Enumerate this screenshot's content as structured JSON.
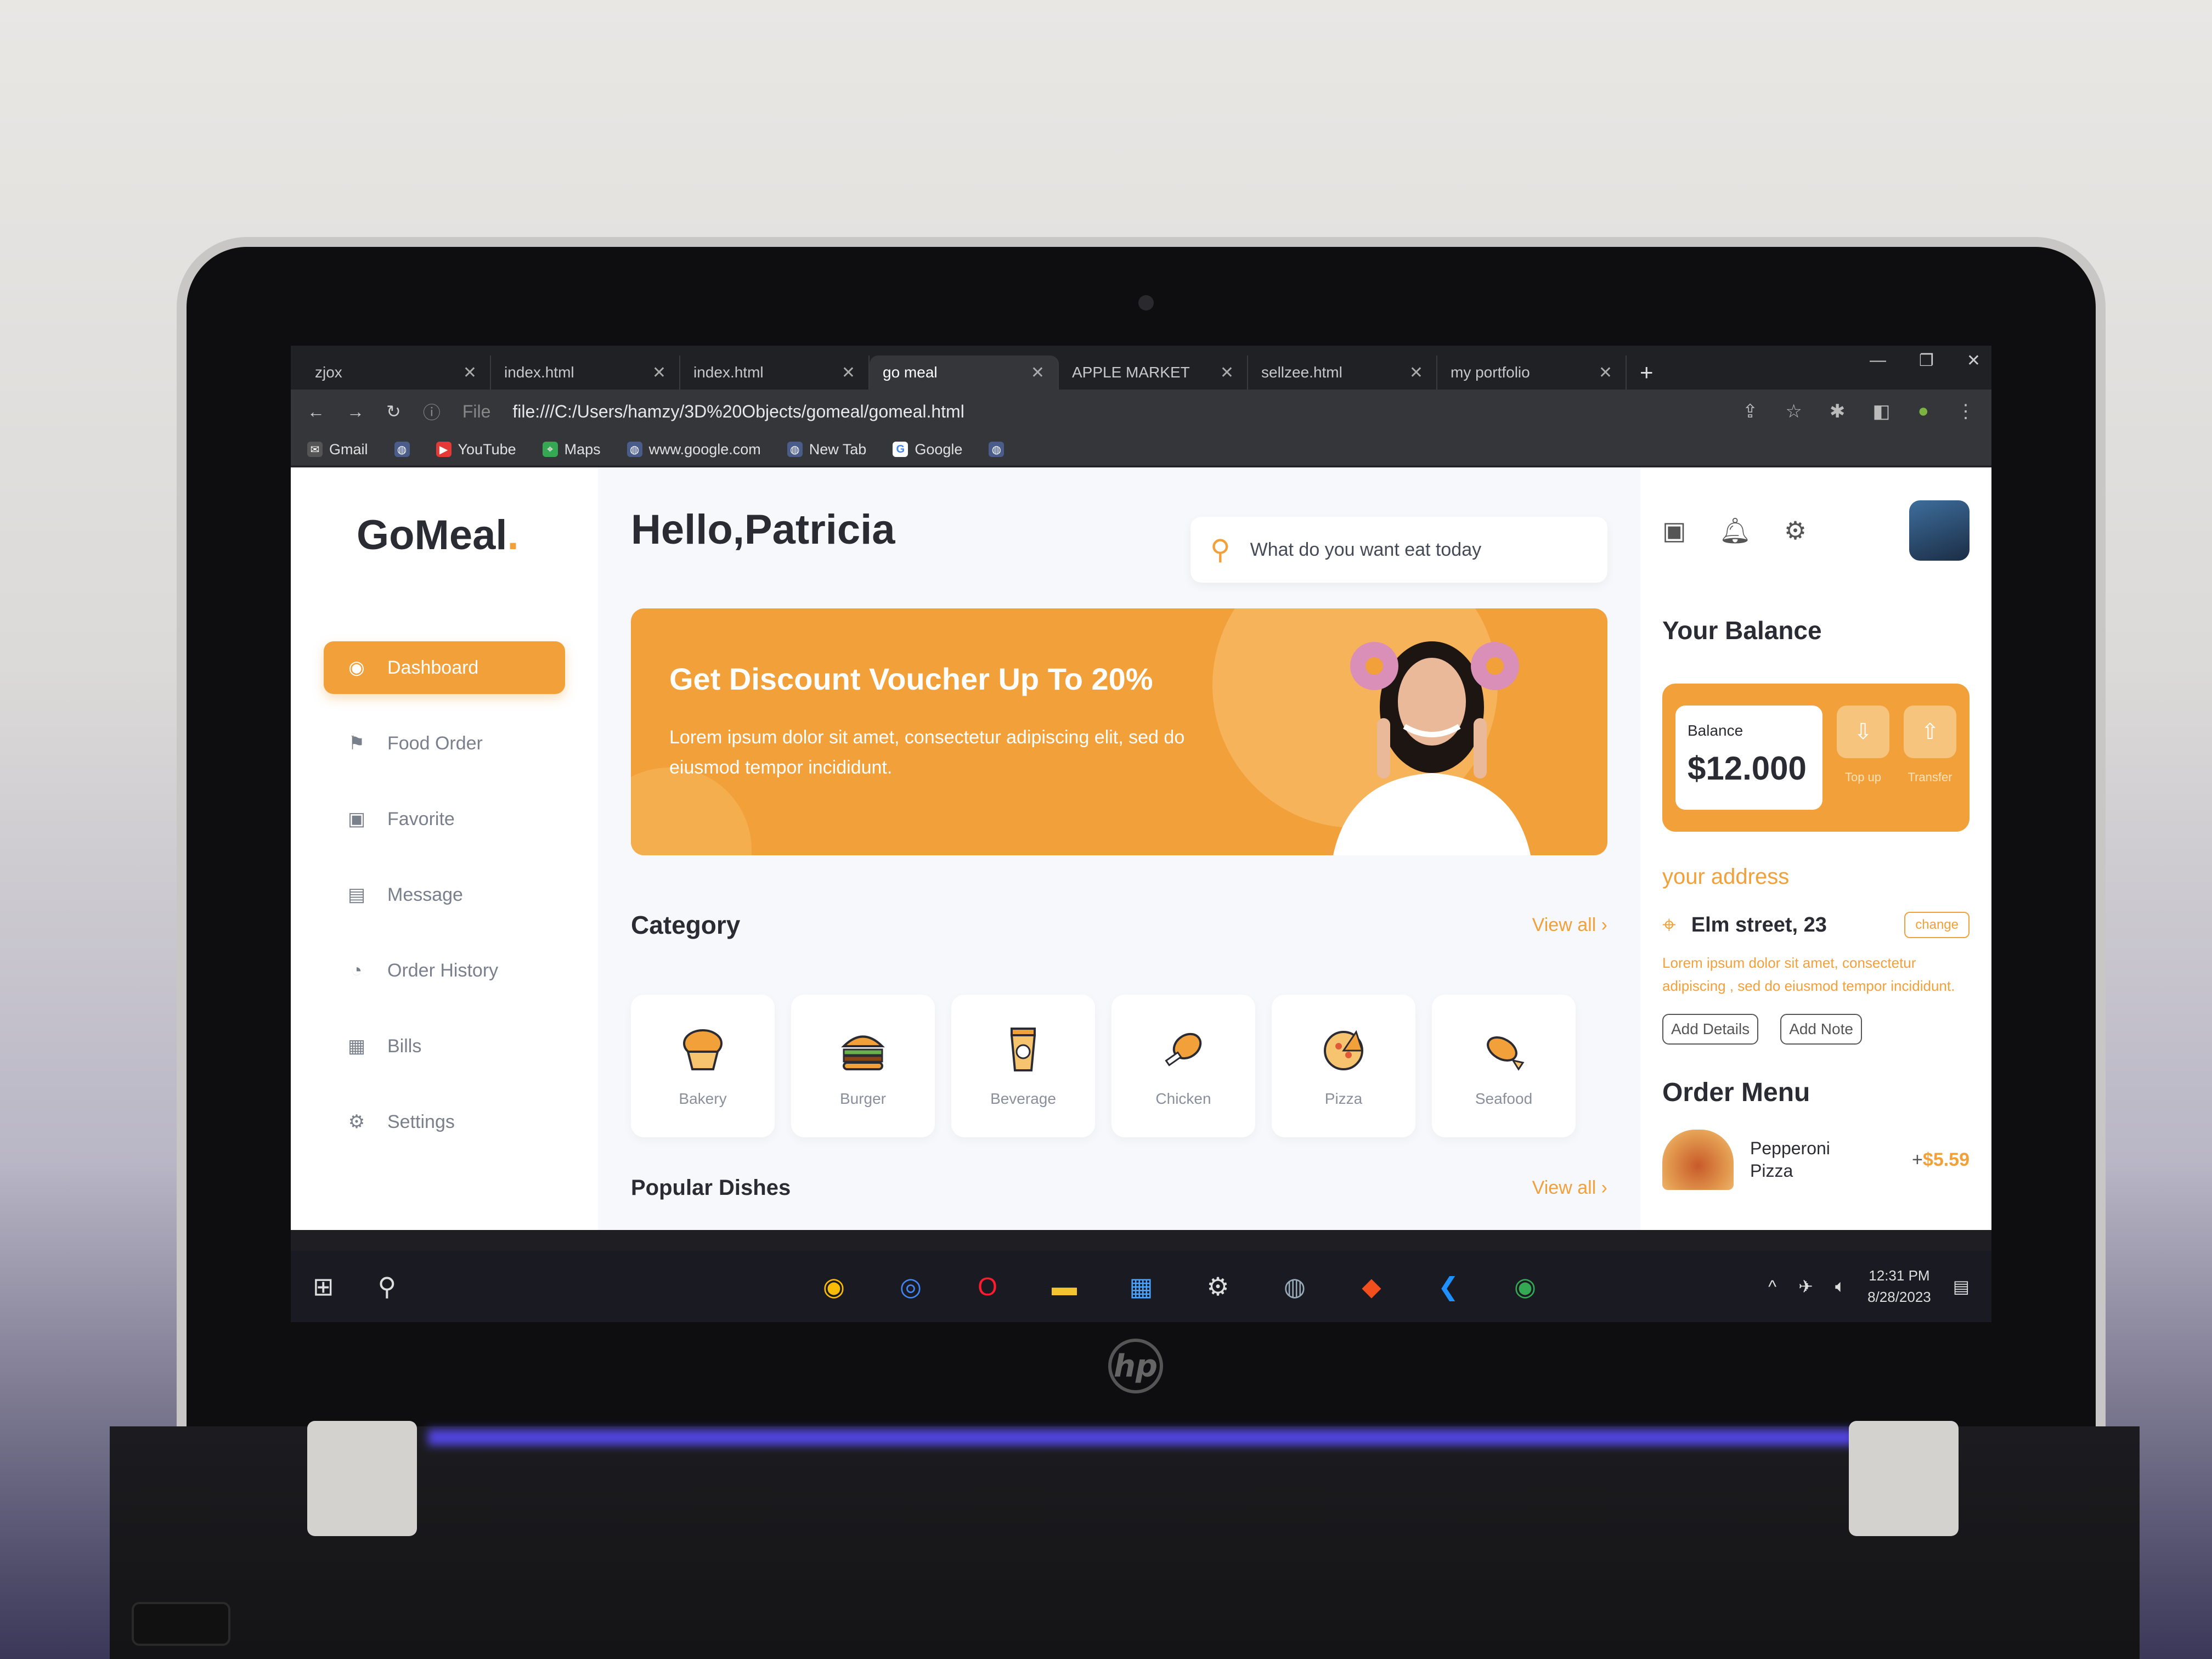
{
  "browser": {
    "tabs": [
      {
        "label": "zjox",
        "active": false
      },
      {
        "label": "index.html",
        "active": false
      },
      {
        "label": "index.html",
        "active": false
      },
      {
        "label": "go meal",
        "active": true
      },
      {
        "label": "APPLE MARKET",
        "active": false
      },
      {
        "label": "sellzee.html",
        "active": false
      },
      {
        "label": "my portfolio",
        "active": false
      }
    ],
    "url": "file:///C:/Users/hamzy/3D%20Objects/gomeal/gomeal.html",
    "url_prefix": "File",
    "bookmarks": [
      "Gmail",
      "YouTube",
      "Maps",
      "www.google.com",
      "New Tab",
      "Google"
    ]
  },
  "app": {
    "logo": "GoMeal",
    "logo_dot": ".",
    "nav": [
      {
        "label": "Dashboard",
        "icon": "dashboard-icon",
        "active": true
      },
      {
        "label": "Food Order",
        "icon": "food-order-icon",
        "active": false
      },
      {
        "label": "Favorite",
        "icon": "favorite-icon",
        "active": false
      },
      {
        "label": "Message",
        "icon": "message-icon",
        "active": false
      },
      {
        "label": "Order History",
        "icon": "order-history-icon",
        "active": false
      },
      {
        "label": "Bills",
        "icon": "bills-icon",
        "active": false
      },
      {
        "label": "Settings",
        "icon": "settings-icon",
        "active": false
      }
    ],
    "greeting": "Hello,Patricia",
    "search_placeholder": "What do you want eat today",
    "banner": {
      "title": "Get Discount Voucher Up To 20%",
      "text": "Lorem ipsum dolor sit amet, consectetur adipiscing elit, sed do eiusmod tempor incididunt."
    },
    "category_title": "Category",
    "view_all": "View all",
    "categories": [
      "Bakery",
      "Burger",
      "Beverage",
      "Chicken",
      "Pizza",
      "Seafood"
    ],
    "popular_title": "Popular Dishes",
    "balance": {
      "title": "Your Balance",
      "label": "Balance",
      "amount": "$12.000",
      "top_up": "Top up",
      "transfer": "Transfer"
    },
    "address": {
      "title": "your address",
      "street": "Elm street, 23",
      "change": "change",
      "desc": "Lorem ipsum dolor sit amet, consectetur adipiscing , sed do eiusmod tempor incididunt.",
      "add_details": "Add Details",
      "add_note": "Add Note"
    },
    "order": {
      "title": "Order Menu",
      "items": [
        {
          "name": "Pepperoni Pizza",
          "qty": "+",
          "price": "$5.59"
        }
      ]
    },
    "colors": {
      "accent": "#f2a03a",
      "text": "#2b2b33"
    }
  },
  "taskbar": {
    "time": "12:31 PM",
    "date": "8/28/2023"
  },
  "device_brand": "hp"
}
